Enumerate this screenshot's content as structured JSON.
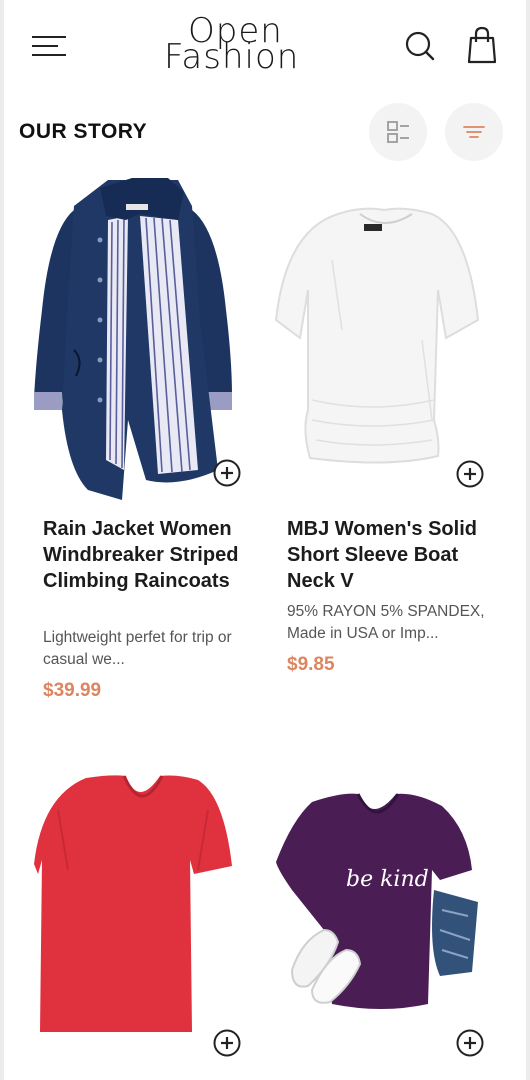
{
  "header": {
    "logo_line1": "Open",
    "logo_line2": "Fashion"
  },
  "section": {
    "title": "OUR STORY"
  },
  "colors": {
    "accent": "#dd8560",
    "text": "#1c1c1c",
    "muted": "#555555",
    "button_bg": "#f3f3f3"
  },
  "products": [
    {
      "title": "Rain Jacket Women Windbreaker Striped Climbing Raincoats",
      "description": "Lightweight perfet for trip or casual we...",
      "price": "$39.99",
      "image": "navy-rain-jacket"
    },
    {
      "title": "MBJ Women's Solid Short Sleeve Boat Neck V",
      "description": "95% RAYON 5% SPANDEX, Made in USA or Imp...",
      "price": "$9.85",
      "image": "white-top"
    },
    {
      "title": "",
      "description": "",
      "price": "",
      "image": "red-v-neck-tshirt"
    },
    {
      "title": "",
      "description": "",
      "price": "",
      "image": "purple-be-kind-tshirt",
      "print_text": "be kind"
    }
  ],
  "icons": [
    "menu-icon",
    "search-icon",
    "shopping-bag-icon",
    "list-view-icon",
    "filter-icon",
    "add-circle-icon"
  ]
}
